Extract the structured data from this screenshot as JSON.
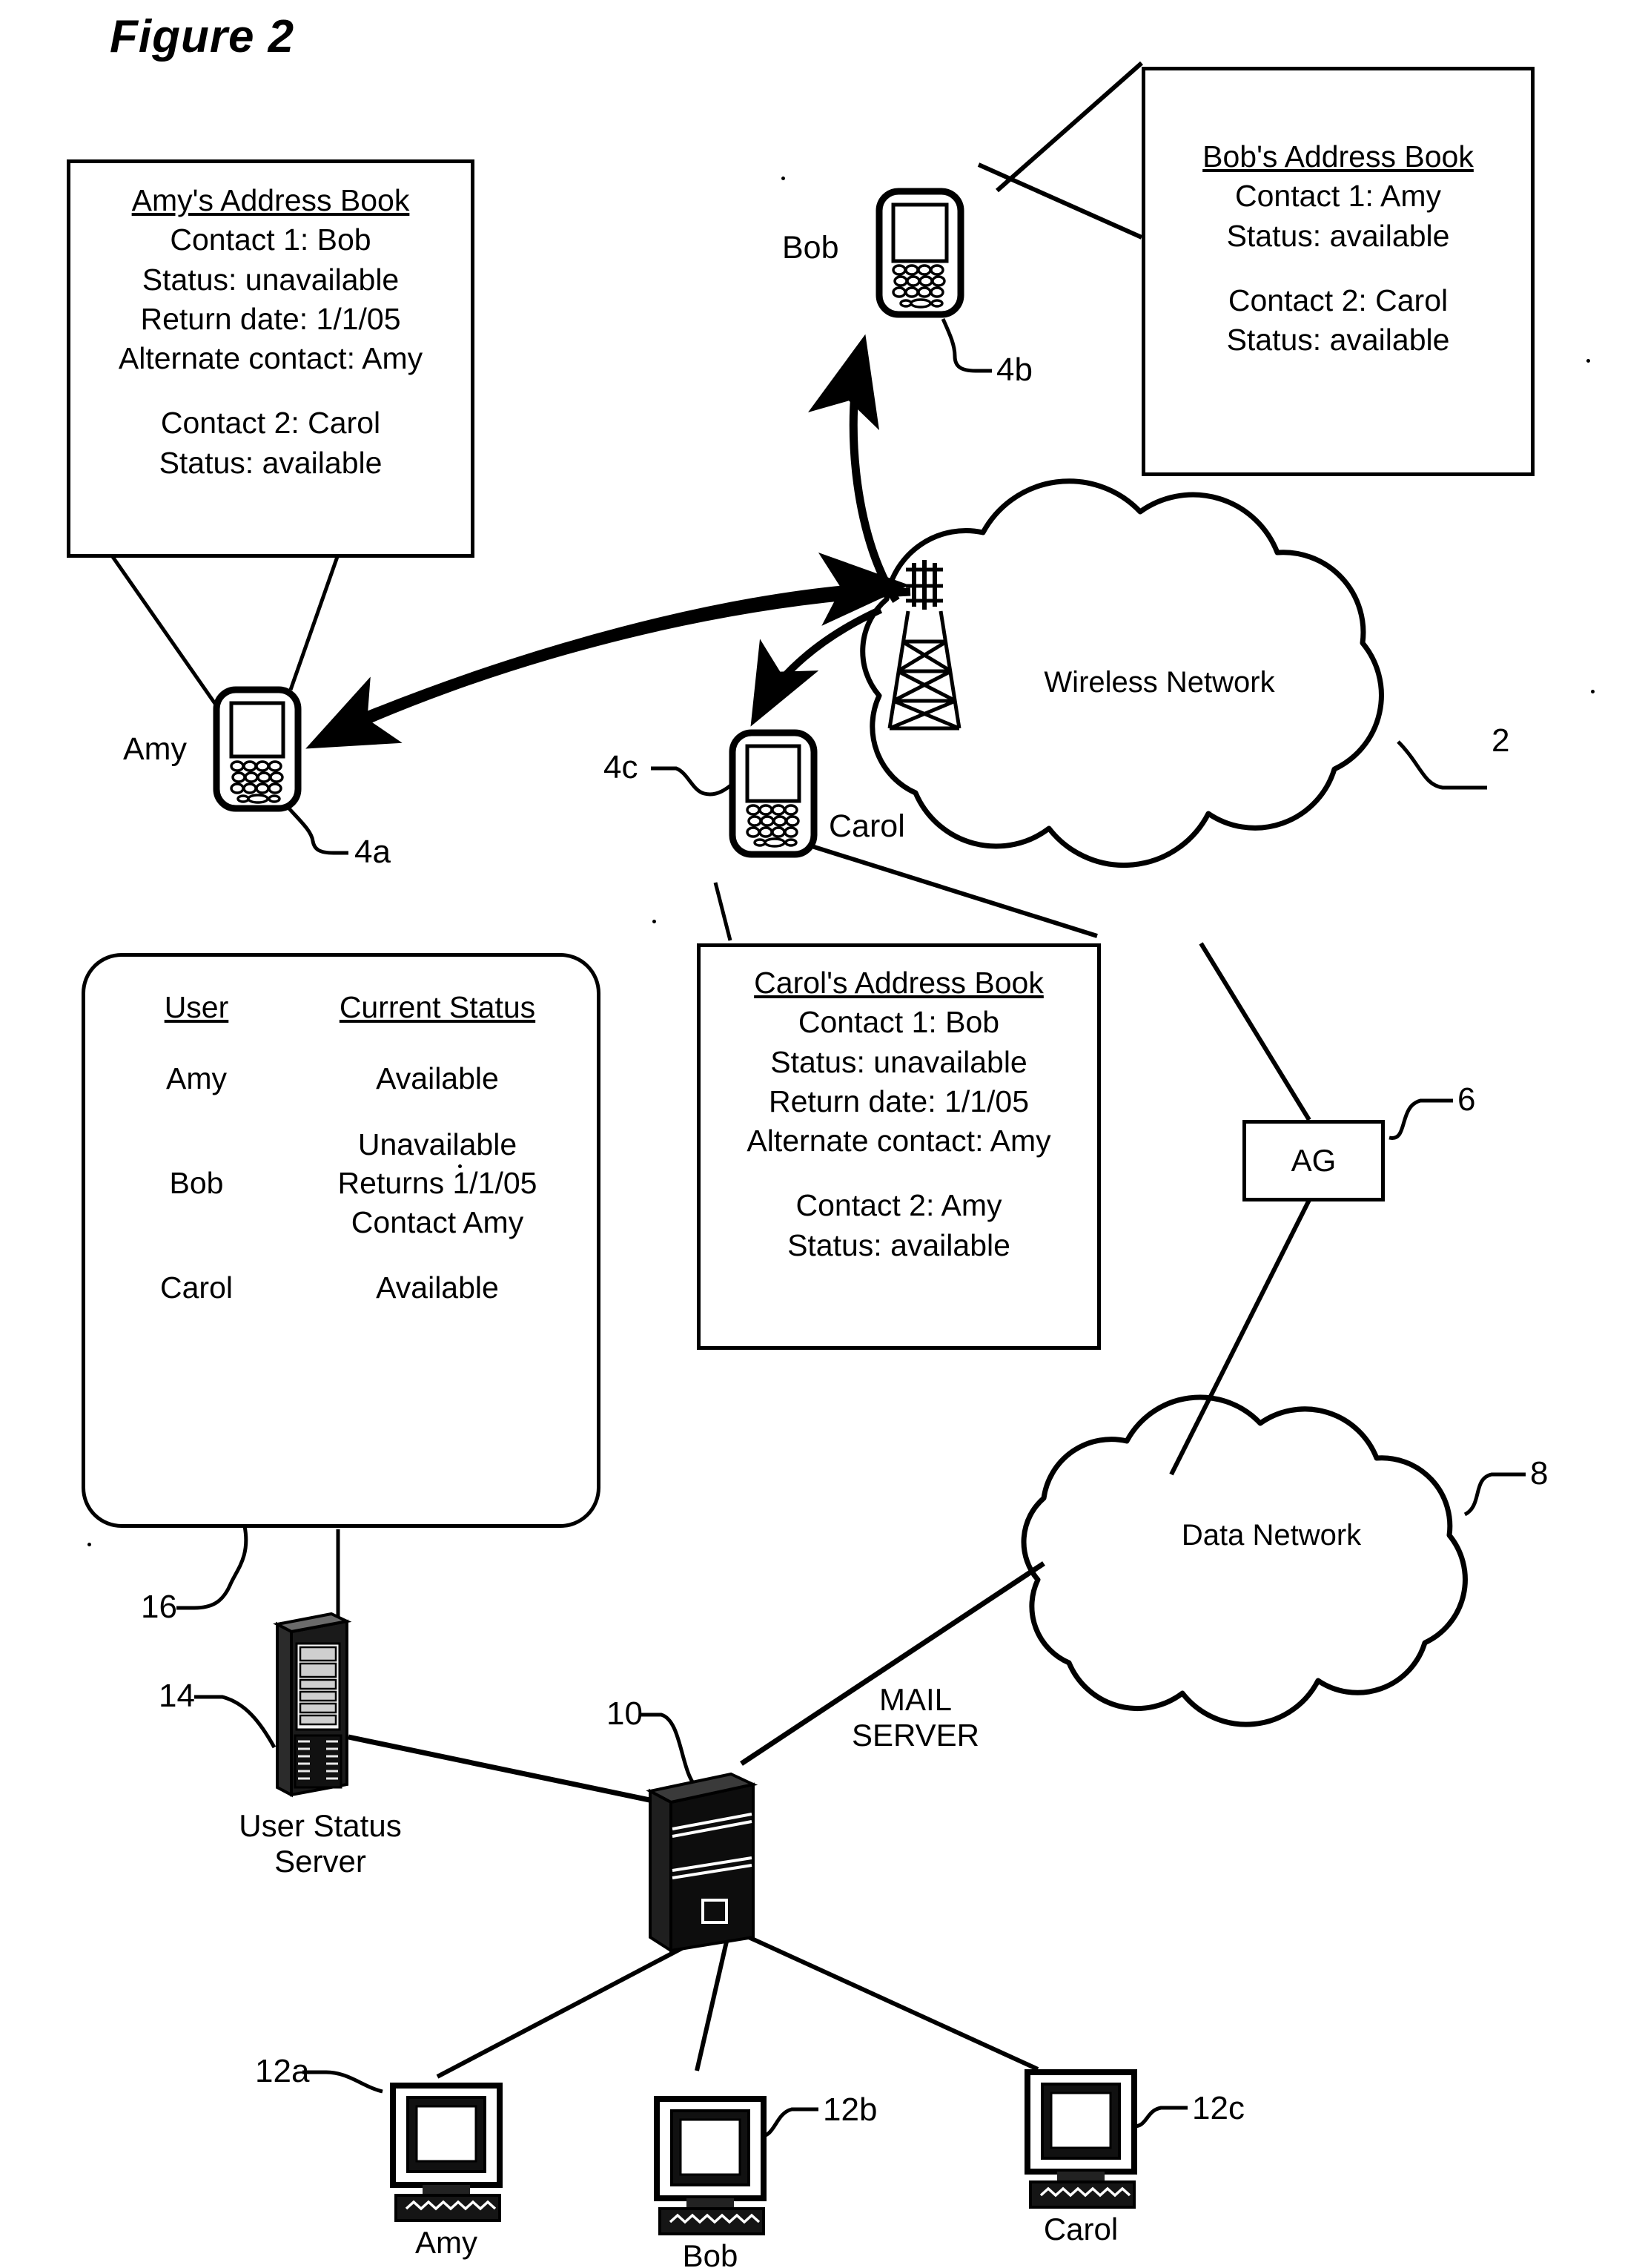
{
  "figure": {
    "title": "Figure 2"
  },
  "address_books": {
    "amy": {
      "title": "Amy's Address Book",
      "lines_group1": [
        "Contact 1: Bob",
        "Status: unavailable",
        "Return date: 1/1/05",
        "Alternate contact: Amy"
      ],
      "lines_group2": [
        "Contact 2: Carol",
        "Status: available"
      ]
    },
    "bob": {
      "title": "Bob's Address Book",
      "lines_group1": [
        "Contact 1: Amy",
        "Status: available"
      ],
      "lines_group2": [
        "Contact 2: Carol",
        "Status: available"
      ]
    },
    "carol": {
      "title": "Carol's Address Book",
      "lines_group1": [
        "Contact 1: Bob",
        "Status: unavailable",
        "Return date: 1/1/05",
        "Alternate contact: Amy"
      ],
      "lines_group2": [
        "Contact 2: Amy",
        "Status: available"
      ]
    }
  },
  "status_table": {
    "headers": [
      "User",
      "Current Status"
    ],
    "rows": [
      {
        "user": "Amy",
        "status": [
          "Available"
        ]
      },
      {
        "user": "Bob",
        "status": [
          "Unavailable",
          "Returns 1/1/05",
          "Contact Amy"
        ]
      },
      {
        "user": "Carol",
        "status": [
          "Available"
        ]
      }
    ]
  },
  "nodes": {
    "wireless_network": "Wireless Network",
    "data_network": "Data Network",
    "ag": "AG",
    "user_status_server": "User Status\nServer",
    "user_status_server_line1": "User Status",
    "user_status_server_line2": "Server",
    "mail_server_line1": "MAIL",
    "mail_server_line2": "SERVER"
  },
  "device_names": {
    "amy_handheld": "Amy",
    "bob_handheld": "Bob",
    "carol_handheld": "Carol",
    "amy_desktop": "Amy",
    "bob_desktop": "Bob",
    "carol_desktop": "Carol"
  },
  "reference_numerals": {
    "wireless_network": "2",
    "handheld_amy": "4a",
    "handheld_bob": "4b",
    "handheld_carol": "4c",
    "ag": "6",
    "data_network": "8",
    "mail_server": "10",
    "desktop_amy": "12a",
    "desktop_bob": "12b",
    "desktop_carol": "12c",
    "user_status_server": "14",
    "status_store": "16"
  },
  "colors": {
    "ink": "#000000",
    "paper": "#ffffff"
  }
}
